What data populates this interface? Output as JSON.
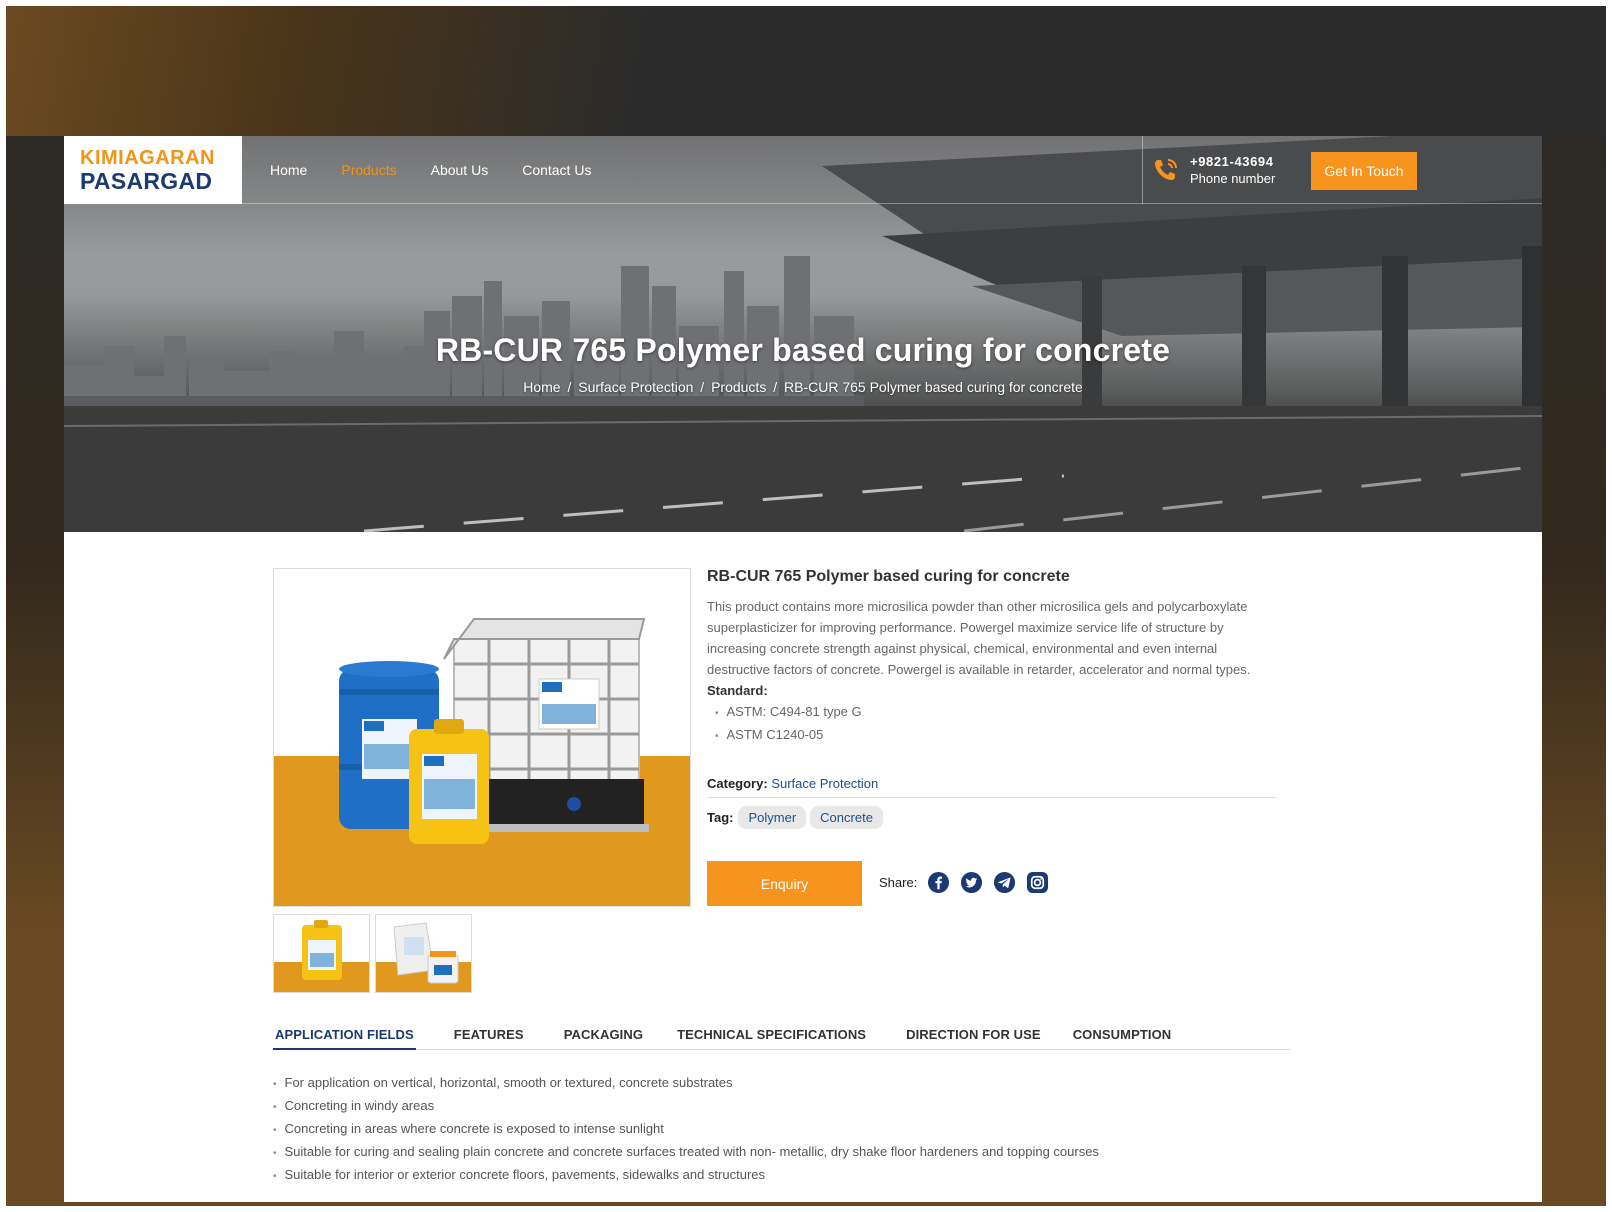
{
  "brand": {
    "logo_line1": "KIMIAGARAN",
    "logo_line2": "PASARGAD"
  },
  "nav": {
    "items": [
      {
        "label": "Home"
      },
      {
        "label": "Products"
      },
      {
        "label": "About Us"
      },
      {
        "label": "Contact Us"
      }
    ],
    "active": "Products"
  },
  "contact": {
    "phone": "+9821-43694",
    "phone_label": "Phone number",
    "cta": "Get In Touch"
  },
  "hero": {
    "title": "RB-CUR 765 Polymer based curing for concrete",
    "breadcrumb": [
      "Home",
      "Surface Protection",
      "Products",
      "RB-CUR 765 Polymer based curing for concrete"
    ],
    "separator": "/"
  },
  "product": {
    "name": "RB-CUR 765 Polymer based curing for concrete",
    "description": "This product contains more microsilica powder than other microsilica gels and polycarboxylate superplasticizer for improving performance. Powergel maximize service life of structure by increasing concrete strength against physical, chemical, environmental and even internal destructive factors of concrete. Powergel is available in retarder, accelerator and normal types.",
    "standard_label": "Standard:",
    "standards": [
      "ASTM: C494-81 type G",
      "ASTM C1240-05"
    ],
    "category_label": "Category:",
    "category": "Surface Protection",
    "tag_label": "Tag:",
    "tags": [
      "Polymer",
      "Concrete"
    ],
    "enquiry": "Enquiry",
    "share_label": "Share:",
    "share_icons": [
      "facebook-icon",
      "twitter-icon",
      "telegram-icon",
      "instagram-icon"
    ]
  },
  "tabs": [
    {
      "label": "APPLICATION FIELDS"
    },
    {
      "label": "FEATURES"
    },
    {
      "label": "PACKAGING"
    },
    {
      "label": "TECHNICAL SPECIFICATIONS"
    },
    {
      "label": "DIRECTION FOR USE"
    },
    {
      "label": "CONSUMPTION"
    }
  ],
  "active_tab": "APPLICATION FIELDS",
  "application_fields": [
    "For application on vertical, horizontal, smooth or textured, concrete substrates",
    "Concreting in windy areas",
    "Concreting in areas where concrete is exposed to intense sunlight",
    "Suitable for curing and sealing plain concrete and concrete surfaces treated with non- metallic, dry shake floor hardeners and topping courses",
    "Suitable for interior or exterior concrete floors, pavements, sidewalks and structures"
  ],
  "colors": {
    "accent": "#f7941d",
    "brand_blue": "#1b3a73",
    "link": "#1f4e8c"
  }
}
